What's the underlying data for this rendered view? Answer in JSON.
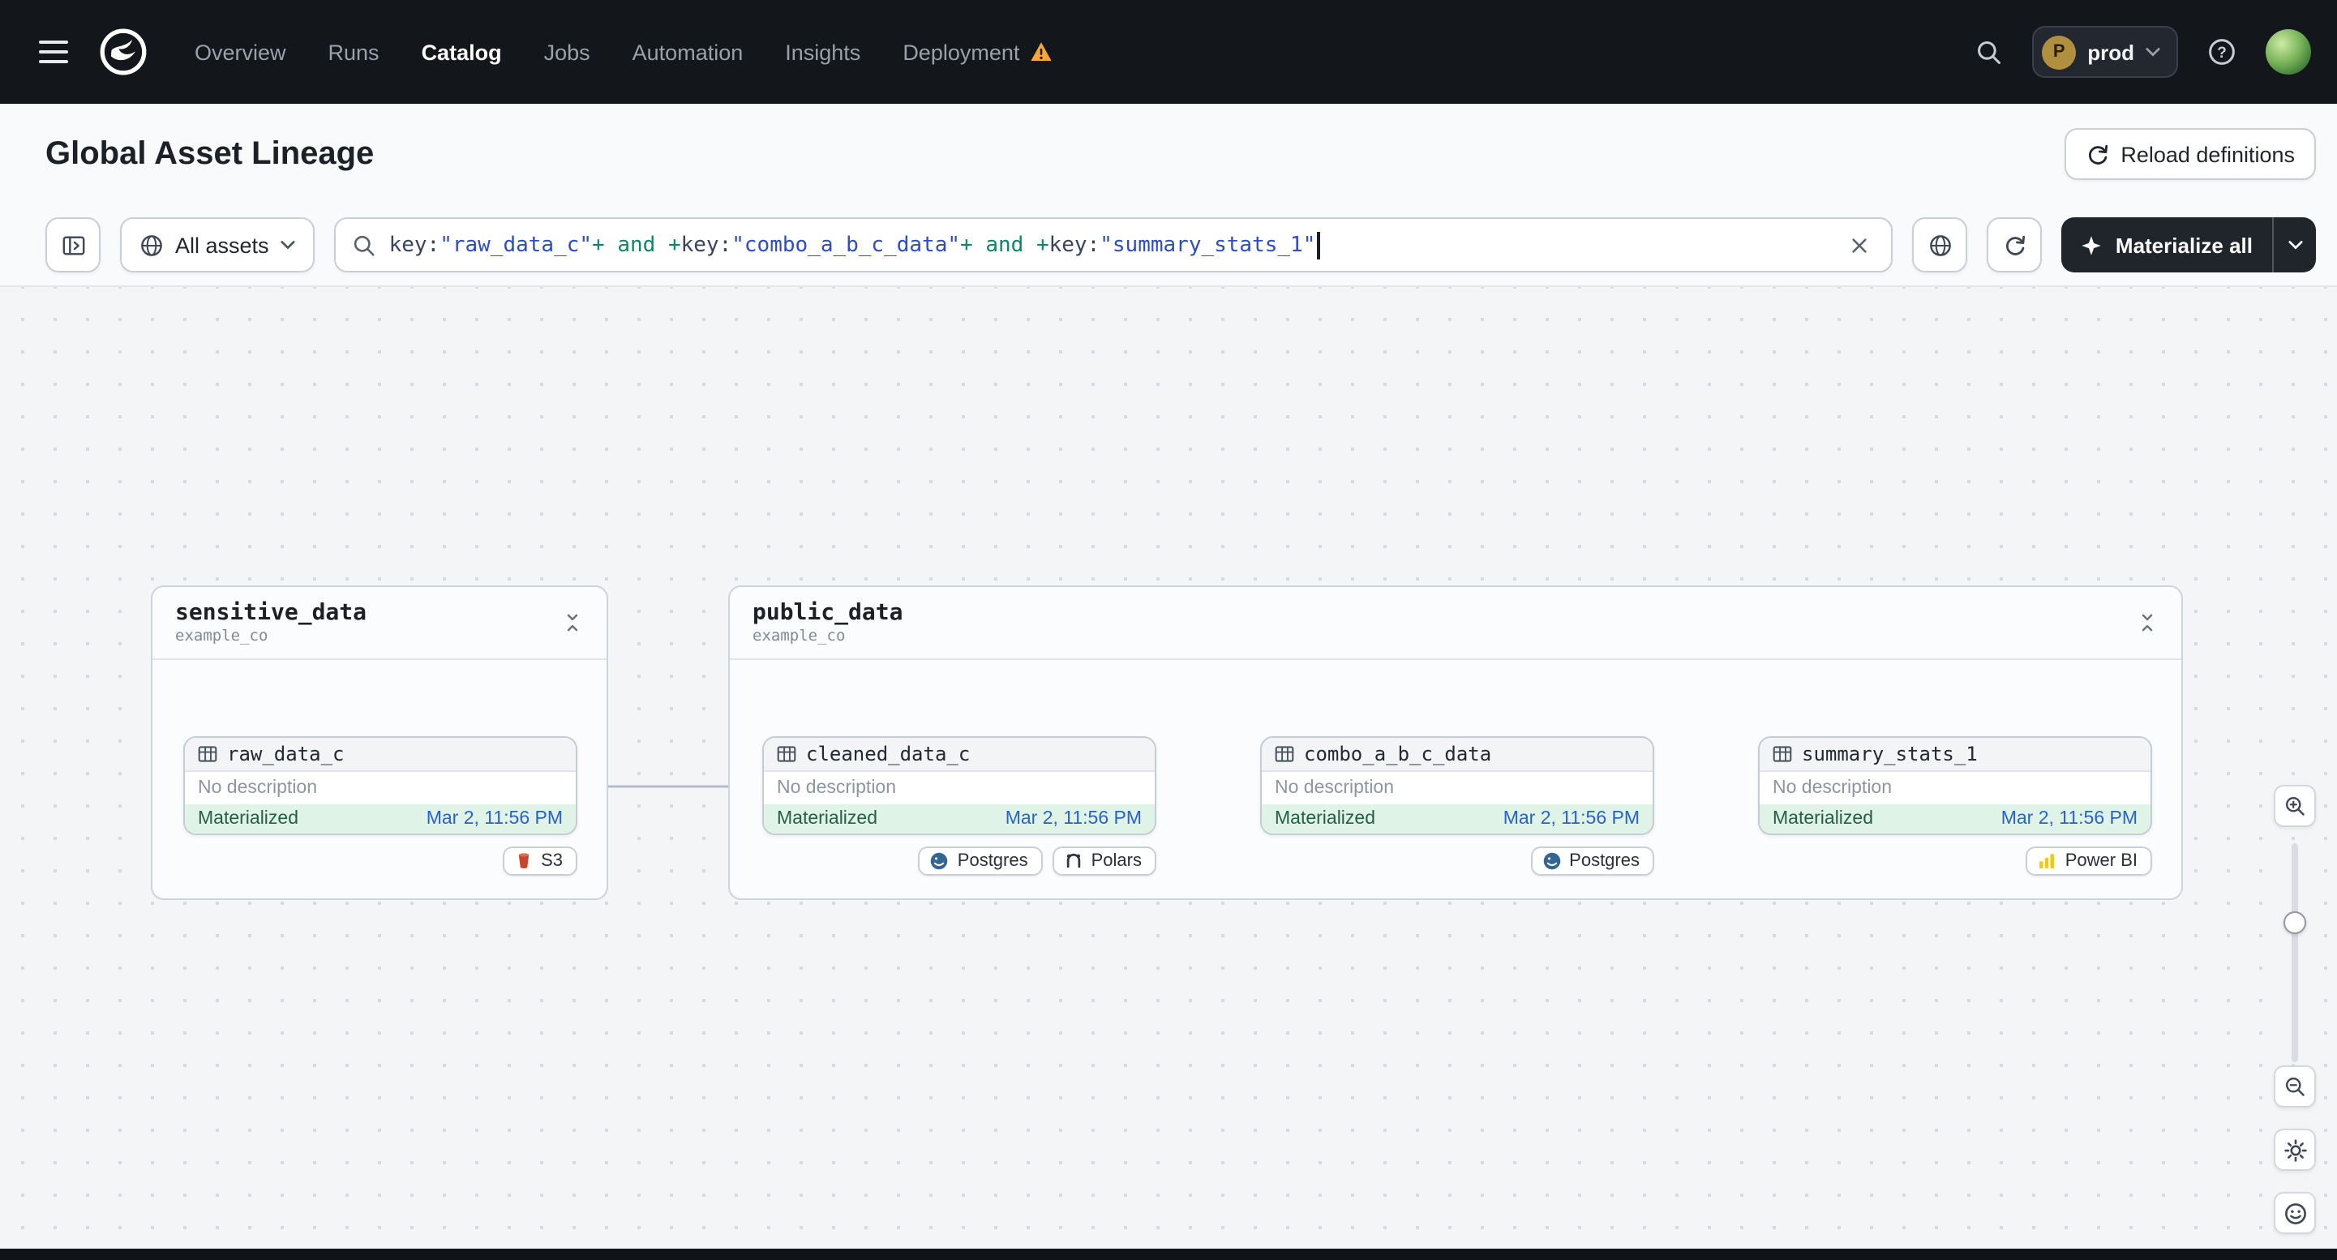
{
  "navbar": {
    "items": [
      {
        "label": "Overview"
      },
      {
        "label": "Runs"
      },
      {
        "label": "Catalog"
      },
      {
        "label": "Jobs"
      },
      {
        "label": "Automation"
      },
      {
        "label": "Insights"
      },
      {
        "label": "Deployment",
        "warning": true
      }
    ],
    "active": "Catalog",
    "env": {
      "initial": "P",
      "label": "prod"
    }
  },
  "header": {
    "title": "Global Asset Lineage",
    "reload_label": "Reload definitions"
  },
  "toolbar": {
    "filter_label": "All assets",
    "materialize_label": "Materialize all",
    "query_tokens": [
      {
        "text": "key:",
        "type": "attr"
      },
      {
        "text": "\"raw_data_c\"",
        "type": "value"
      },
      {
        "text": "+",
        "type": "op"
      },
      {
        "text": " and ",
        "type": "keyword"
      },
      {
        "text": "+",
        "type": "op"
      },
      {
        "text": "key:",
        "type": "attr"
      },
      {
        "text": "\"combo_a_b_c_data\"",
        "type": "value"
      },
      {
        "text": "+",
        "type": "op"
      },
      {
        "text": " and ",
        "type": "keyword"
      },
      {
        "text": "+",
        "type": "op"
      },
      {
        "text": "key:",
        "type": "attr"
      },
      {
        "text": "\"summary_stats_1\"",
        "type": "value"
      }
    ]
  },
  "graph": {
    "groups": [
      {
        "name": "sensitive_data",
        "repo": "example_co",
        "nodes": [
          {
            "name": "raw_data_c",
            "description": "No description",
            "status": "Materialized",
            "timestamp": "Mar 2, 11:56 PM",
            "tags": [
              {
                "label": "S3",
                "icon": "s3-icon"
              }
            ]
          }
        ]
      },
      {
        "name": "public_data",
        "repo": "example_co",
        "nodes": [
          {
            "name": "cleaned_data_c",
            "description": "No description",
            "status": "Materialized",
            "timestamp": "Mar 2, 11:56 PM",
            "tags": [
              {
                "label": "Postgres",
                "icon": "postgres-icon"
              },
              {
                "label": "Polars",
                "icon": "polars-icon"
              }
            ]
          },
          {
            "name": "combo_a_b_c_data",
            "description": "No description",
            "status": "Materialized",
            "timestamp": "Mar 2, 11:56 PM",
            "tags": [
              {
                "label": "Postgres",
                "icon": "postgres-icon"
              }
            ]
          },
          {
            "name": "summary_stats_1",
            "description": "No description",
            "status": "Materialized",
            "timestamp": "Mar 2, 11:56 PM",
            "tags": [
              {
                "label": "Power BI",
                "icon": "powerbi-icon"
              }
            ]
          }
        ]
      }
    ]
  },
  "zoom_rail": {
    "icons": [
      "zoom-in-icon",
      "zoom-slider",
      "zoom-out-icon",
      "gear-icon",
      "smiley-icon"
    ]
  },
  "colors": {
    "navbar_bg": "#13161B",
    "warning": "#F5A73B",
    "materialized_bg": "#DFF3E6",
    "materialized_text": "#265F46",
    "timestamp_link": "#2962CC",
    "query_value": "#2F4CC0",
    "query_keyword": "#0F8668",
    "materialize_button_bg": "#20242B"
  }
}
